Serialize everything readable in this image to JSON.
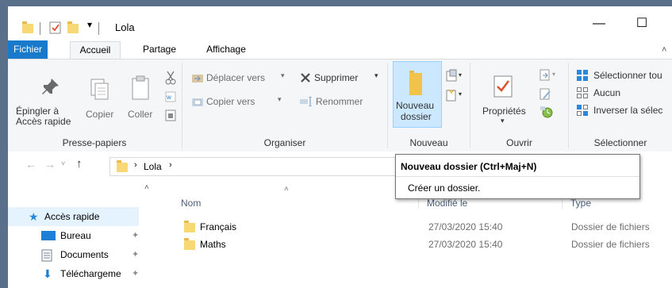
{
  "window": {
    "title": "Lola"
  },
  "menu": {
    "file": "Fichier",
    "home": "Accueil",
    "share": "Partage",
    "view": "Affichage"
  },
  "ribbon": {
    "clipboard": {
      "pin": "Épingler à\nAccès rapide",
      "pin_l1": "Épingler à",
      "pin_l2": "Accès rapide",
      "copy": "Copier",
      "paste": "Coller",
      "label": "Presse-papiers"
    },
    "organize": {
      "move_to": "Déplacer vers",
      "copy_to": "Copier vers",
      "delete": "Supprimer",
      "rename": "Renommer",
      "label": "Organiser"
    },
    "new": {
      "new_folder_l1": "Nouveau",
      "new_folder_l2": "dossier",
      "label": "Nouveau"
    },
    "open": {
      "properties": "Propriétés",
      "label": "Ouvrir"
    },
    "select": {
      "select_all": "Sélectionner tou",
      "none": "Aucun",
      "invert": "Inverser la sélec",
      "label": "Sélectionner"
    }
  },
  "address": {
    "crumb": "Lola"
  },
  "tooltip": {
    "title": "Nouveau dossier (Ctrl+Maj+N)",
    "body": "Créer un dossier."
  },
  "nav": {
    "items": [
      {
        "label": "Accès rapide",
        "icon": "star-icon"
      },
      {
        "label": "Bureau",
        "icon": "desktop-icon"
      },
      {
        "label": "Documents",
        "icon": "documents-icon"
      },
      {
        "label": "Téléchargeme",
        "icon": "download-icon"
      }
    ]
  },
  "columns": {
    "name": "Nom",
    "modified": "Modifié le",
    "type": "Type"
  },
  "files": [
    {
      "name": "Français",
      "modified": "27/03/2020 15:40",
      "type": "Dossier de fichiers"
    },
    {
      "name": "Maths",
      "modified": "27/03/2020 15:40",
      "type": "Dossier de fichiers"
    }
  ],
  "colors": {
    "accent": "#1979ca",
    "folder": "#f8d775",
    "selected": "#cce8ff"
  }
}
